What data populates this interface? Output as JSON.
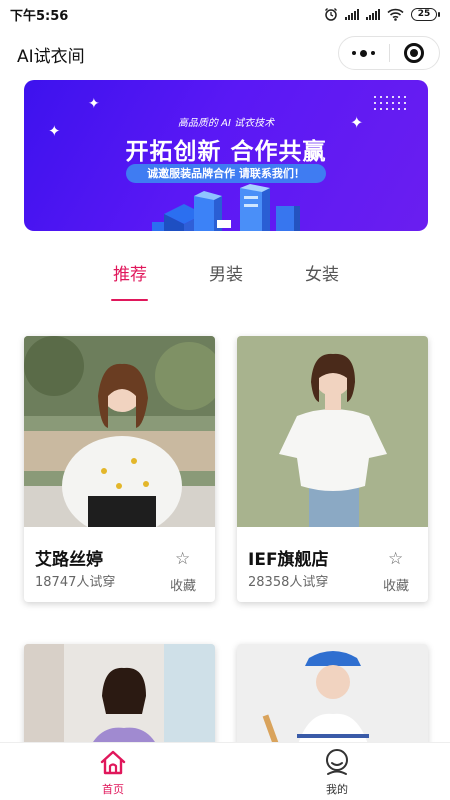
{
  "status_bar": {
    "time": "下午5:56",
    "battery": "25"
  },
  "header": {
    "title": "AI试衣间"
  },
  "banner": {
    "subtitle": "高品质的 AI 试衣技术",
    "headline": "开拓创新 合作共赢",
    "pill": "诚邀服装品牌合作 请联系我们！"
  },
  "tabs": [
    {
      "label": "推荐",
      "active": true
    },
    {
      "label": "男装",
      "active": false
    },
    {
      "label": "女装",
      "active": false
    }
  ],
  "cards": [
    {
      "name": "艾路丝婷",
      "count": "18747人试穿",
      "fav_label": "收藏"
    },
    {
      "name": "IEF旗舰店",
      "count": "28358人试穿",
      "fav_label": "收藏"
    },
    {
      "name": "",
      "count": "",
      "fav_label": ""
    },
    {
      "name": "",
      "count": "",
      "fav_label": ""
    }
  ],
  "tabbar": [
    {
      "label": "首页",
      "icon": "home-icon",
      "active": true
    },
    {
      "label": "我的",
      "icon": "profile-icon",
      "active": false
    }
  ],
  "colors": {
    "accent": "#e0175b",
    "banner": "#4a14f0",
    "pill": "#3f7cf2"
  }
}
